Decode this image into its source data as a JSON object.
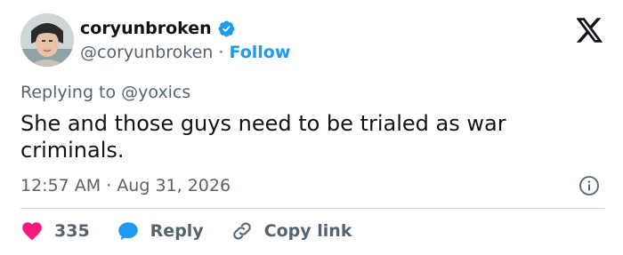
{
  "author": {
    "display_name": "coryunbroken",
    "handle": "@coryunbroken",
    "separator": " · ",
    "follow_label": "Follow"
  },
  "reply": {
    "prefix": "Replying to ",
    "mention": "@yoxics"
  },
  "tweet": {
    "text": "She and those guys need to be trialed as war criminals.",
    "time": "12:57 AM",
    "separator": " · ",
    "date": "Aug 31, 2026"
  },
  "actions": {
    "like_count": "335",
    "reply_label": "Reply",
    "copy_link_label": "Copy link"
  },
  "icons": {
    "verified": "verified-badge-icon",
    "platform": "x-logo-icon",
    "info": "info-icon",
    "like": "heart-icon",
    "reply": "speech-bubble-icon",
    "copy": "link-icon"
  },
  "colors": {
    "accent": "#1d9bf0",
    "like": "#f91880",
    "text": "#0f1419",
    "secondary": "#536471"
  }
}
